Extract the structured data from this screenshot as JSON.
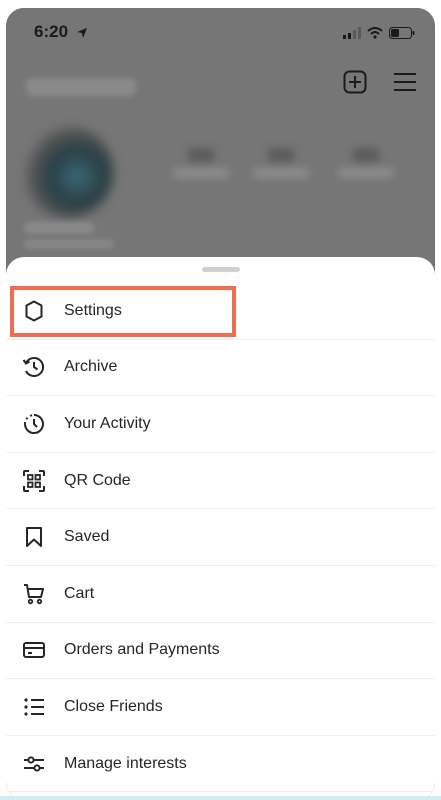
{
  "status_bar": {
    "time": "6:20",
    "icons": [
      "location-arrow-icon",
      "signal-icon",
      "wifi-icon",
      "battery-icon"
    ]
  },
  "header": {
    "icons": [
      "new-post-icon",
      "hamburger-menu-icon"
    ]
  },
  "menu": {
    "items": [
      {
        "label": "Settings",
        "icon": "settings-gear-icon",
        "highlighted": true
      },
      {
        "label": "Archive",
        "icon": "archive-history-icon"
      },
      {
        "label": "Your Activity",
        "icon": "activity-clock-icon"
      },
      {
        "label": "QR Code",
        "icon": "qr-code-icon"
      },
      {
        "label": "Saved",
        "icon": "bookmark-icon"
      },
      {
        "label": "Cart",
        "icon": "cart-icon"
      },
      {
        "label": "Orders and Payments",
        "icon": "credit-card-icon"
      },
      {
        "label": "Close Friends",
        "icon": "list-icon"
      },
      {
        "label": "Manage interests",
        "icon": "sliders-icon"
      }
    ]
  },
  "colors": {
    "highlight_border": "#f06e4f",
    "overlay": "#767676",
    "sheet": "#ffffff",
    "text": "#262626"
  }
}
